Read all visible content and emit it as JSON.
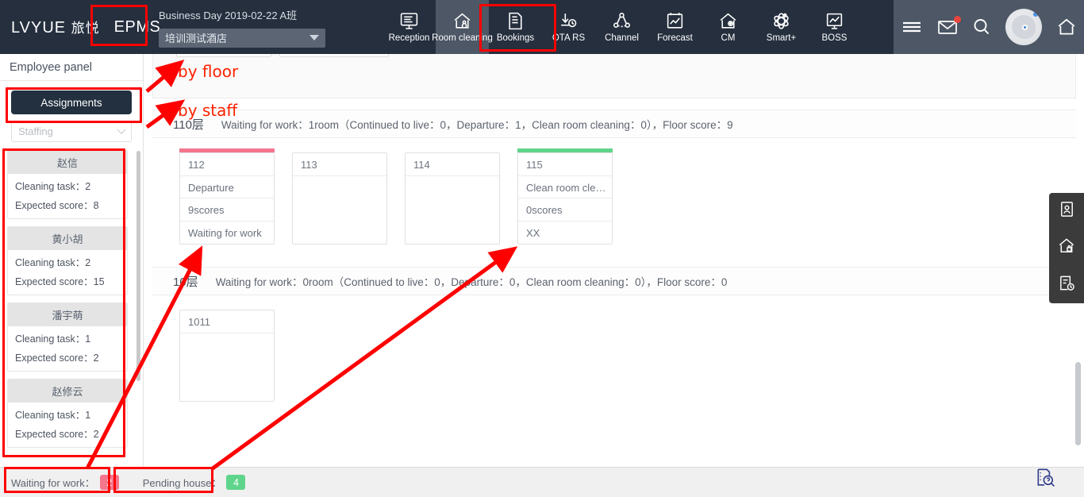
{
  "topbar": {
    "logo_latin": "LVYUE",
    "logo_cn": "旅悦",
    "epms": "EPMS",
    "business_day": "Business Day 2019-02-22 A班",
    "hotel_selected": "培训测试酒店",
    "nav": [
      {
        "label": "Reception",
        "icon": "monitor-icon",
        "active": false
      },
      {
        "label": "Room cleaning",
        "icon": "house-person-icon",
        "active": true
      },
      {
        "label": "Bookings",
        "icon": "document-icon",
        "active": false
      },
      {
        "label": "OTA RS",
        "icon": "download-clock-icon",
        "active": false
      },
      {
        "label": "Channel",
        "icon": "network-nodes-icon",
        "active": false
      },
      {
        "label": "Forecast",
        "icon": "chart-board-icon",
        "active": false
      },
      {
        "label": "CM",
        "icon": "house-gear-icon",
        "active": false
      },
      {
        "label": "Smart+",
        "icon": "atom-icon",
        "active": false
      },
      {
        "label": "BOSS",
        "icon": "presentation-chart-icon",
        "active": false
      }
    ],
    "right_icons": [
      "menu-icon",
      "mail-icon",
      "search-icon",
      "avatar",
      "home-icon"
    ]
  },
  "sidebar": {
    "title": "Employee panel",
    "assignments_label": "Assignments",
    "staffing_placeholder": "Staffing",
    "labels": {
      "cleaning_task": "Cleaning task：",
      "expected_score": "Expected score："
    },
    "staff": [
      {
        "name": "赵信",
        "cleaning_task": "2",
        "expected_score": "8"
      },
      {
        "name": "黄小胡",
        "cleaning_task": "2",
        "expected_score": "15"
      },
      {
        "name": "潘宇萌",
        "cleaning_task": "1",
        "expected_score": "2"
      },
      {
        "name": "赵修云",
        "cleaning_task": "1",
        "expected_score": "2"
      }
    ]
  },
  "main": {
    "floors": [
      {
        "name": "110层",
        "summary": "Waiting for work：1room（Continued to live：0，Departure：1，Clean room cleaning：0），Floor score：9",
        "rooms": [
          {
            "number": "112",
            "strip": "pink",
            "status": "Departure",
            "score": "9scores",
            "extra": "Waiting for work"
          },
          {
            "number": "113",
            "strip": "none",
            "status": "",
            "score": "",
            "extra": ""
          },
          {
            "number": "114",
            "strip": "none",
            "status": "",
            "score": "",
            "extra": ""
          },
          {
            "number": "115",
            "strip": "green",
            "status": "Clean room cle…",
            "score": "0scores",
            "extra": "XX"
          }
        ]
      },
      {
        "name": "10层",
        "summary": "Waiting for work：0room（Continued to live：0，Departure：0，Clean room cleaning：0），Floor score：0",
        "rooms": [
          {
            "number": "1011",
            "strip": "none",
            "status": "",
            "score": "",
            "extra": ""
          }
        ]
      }
    ]
  },
  "bottombar": {
    "waiting_label": "Waiting for work：",
    "waiting_count": "2",
    "pending_label": "Pending house：",
    "pending_count": "4",
    "help_icon": "document-search-help-icon"
  },
  "righttools": {
    "icons": [
      "id-card-icon",
      "house-lock-icon",
      "report-clock-icon"
    ]
  },
  "annotations": {
    "by_floor": "by floor",
    "by_staff": "by staff"
  },
  "colors": {
    "topbar": "#252f3e",
    "topbar_right": "#4d5765",
    "accent_pink": "#f4768d",
    "accent_green": "#5fd48b",
    "annotation_red": "#fe0000",
    "assign_button": "#22303f"
  }
}
